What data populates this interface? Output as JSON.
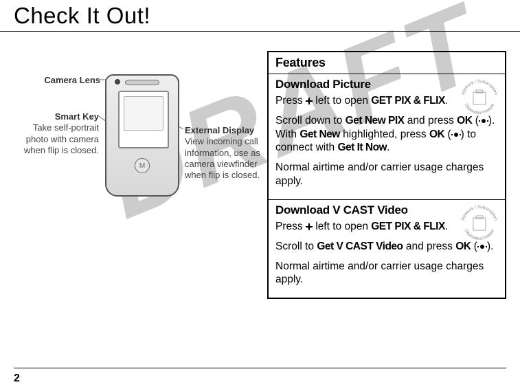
{
  "page_title": "Check It Out!",
  "watermark": "DRAFT",
  "page_number": "2",
  "diagram": {
    "camera_lens": {
      "title": "Camera Lens",
      "body": ""
    },
    "smart_key": {
      "title": "Smart Key",
      "body": "Take self-portrait photo with camera when flip is closed."
    },
    "external_display": {
      "title": "External Display",
      "body": "View incoming call information, use as camera viewfinder when flip is closed."
    },
    "logo_glyph": "M"
  },
  "features": {
    "header": "Features",
    "badge_text_top": "Network / Subscription",
    "badge_text_bottom": "Dependent Feature",
    "items": [
      {
        "title": "Download Picture",
        "p1_a": "Press ",
        "p1_b": " left to open ",
        "p1_c": "GET PIX & FLIX",
        "p1_d": ".",
        "p2_a": "Scroll down to ",
        "p2_b": "Get New PIX",
        "p2_c": " and press ",
        "p2_d": "OK",
        "p2_e": " (",
        "p2_f": "). With ",
        "p2_g": "Get New",
        "p2_h": " highlighted, press ",
        "p2_i": "OK",
        "p2_j": " (",
        "p2_k": ") to connect with ",
        "p2_l": "Get It Now",
        "p2_m": ".",
        "p3": "Normal airtime and/or carrier usage charges apply."
      },
      {
        "title": "Download V CAST Video",
        "p1_a": "Press ",
        "p1_b": " left to open ",
        "p1_c": "GET PIX & FLIX",
        "p1_d": ".",
        "p2_a": "Scroll to ",
        "p2_b": "Get V CAST Video",
        "p2_c": " and press ",
        "p2_d": "OK",
        "p2_e": " (",
        "p2_f": ").",
        "p3": "Normal airtime and/or carrier usage charges apply."
      }
    ]
  }
}
